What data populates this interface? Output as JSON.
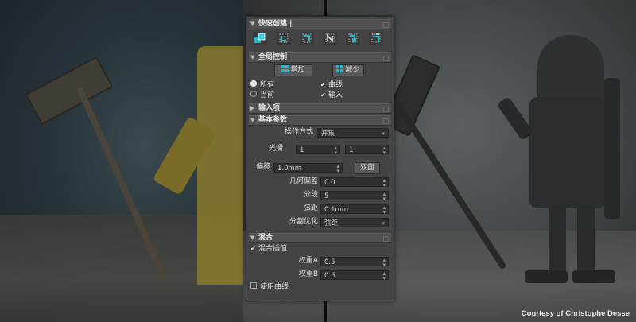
{
  "panel": {
    "quick_create": {
      "title": "快速创建 |"
    },
    "global_control": {
      "title": "全局控制",
      "increase_label": "增加",
      "decrease_label": "减少",
      "opt_all": "所有",
      "opt_current": "当前",
      "opt_curve": "曲线",
      "opt_input": "输入",
      "selected_radio": "所有",
      "checked": [
        "曲线",
        "输入"
      ]
    },
    "input_items": {
      "title": "输入项"
    },
    "basic_params": {
      "title": "基本参数",
      "operation_label": "操作方式",
      "operation_value": "并集",
      "smooth_label": "光滑",
      "smooth_value_1": "1",
      "smooth_value_2": "1",
      "offset_label": "偏移",
      "offset_value": "1.0mm",
      "double_sided_label": "双面",
      "geo_offset_label": "几何偏差",
      "geo_offset_value": "0.0",
      "segments_label": "分段",
      "segments_value": "5",
      "chord_label": "弦距",
      "chord_value": "0.1mm",
      "split_opt_label": "分割优化",
      "split_opt_value": "弦距"
    },
    "blend": {
      "title": "混合",
      "blend_interp_label": "混合插值",
      "blend_interp_checked": true,
      "weight_a_label": "权重A",
      "weight_a_value": "0.5",
      "weight_b_label": "权重B",
      "weight_b_value": "0.5",
      "use_curve_label": "使用曲线",
      "use_curve_checked": false
    }
  },
  "credit": "Courtesy of Christophe Desse",
  "colors": {
    "panel_bg": "#444444",
    "accent_icon": "#2bb3c8"
  }
}
